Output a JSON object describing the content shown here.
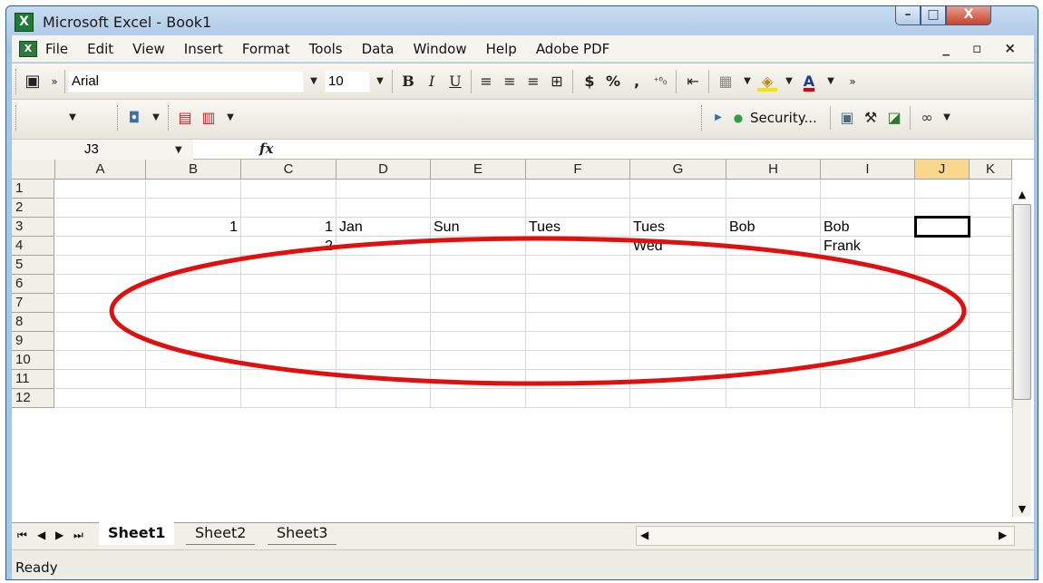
{
  "window": {
    "title": "Microsoft Excel - Book1",
    "minimize": "–",
    "maximize": "□",
    "close": "X"
  },
  "menubar": {
    "items": [
      "File",
      "Edit",
      "View",
      "Insert",
      "Format",
      "Tools",
      "Data",
      "Window",
      "Help",
      "Adobe PDF"
    ],
    "doc_controls": "_ ▫ ×"
  },
  "toolbar1": {
    "font_name": "Arial",
    "font_size": "10",
    "buttons": [
      "B",
      "I",
      "U",
      "≡",
      "≡",
      "≡",
      "⊞",
      "$",
      "%",
      ",",
      "⁺⁰₀",
      "⇤",
      "▦",
      "◈",
      "A"
    ]
  },
  "toolbar2": {
    "security_label": "Security..."
  },
  "formula_bar": {
    "name_box": "J3",
    "fx": "fx",
    "content": ""
  },
  "sheet": {
    "columns": [
      "A",
      "B",
      "C",
      "D",
      "E",
      "F",
      "G",
      "H",
      "I",
      "J",
      "K"
    ],
    "rows": [
      "1",
      "2",
      "3",
      "4",
      "5",
      "6",
      "7",
      "8",
      "9",
      "10",
      "11",
      "12"
    ],
    "cells": {
      "B3": "1",
      "C3": "1",
      "D3": "Jan",
      "E3": "Sun",
      "F3": "Tues",
      "G3": "Tues",
      "H3": "Bob",
      "I3": "Bob",
      "C4": "2",
      "G4": "Wed",
      "I4": "Frank"
    },
    "active_cell": "J3"
  },
  "tabs": {
    "sheets": [
      "Sheet1",
      "Sheet2",
      "Sheet3"
    ],
    "active": "Sheet1"
  },
  "status": {
    "text": "Ready"
  },
  "annotation": {
    "color": "#e01010"
  }
}
